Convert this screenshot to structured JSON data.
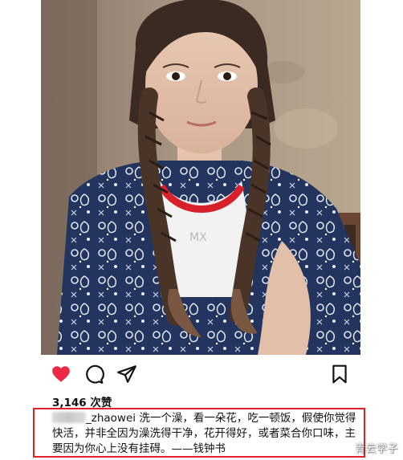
{
  "post": {
    "photo": {
      "subject": "selfie-photo"
    },
    "actions": {
      "like_icon": "heart-icon",
      "comment_icon": "comment-icon",
      "share_icon": "send-icon",
      "save_icon": "bookmark-icon",
      "like_color": "#ed2a45"
    },
    "likes_text": "3,146 次赞",
    "caption": {
      "username": "_zhaowei",
      "text": " 洗一个澡，看一朵花，吃一顿饭，假使你觉得快活，并非全因为澡洗得干净，花开得好，或者菜合你口味，主要因为你心上没有挂碍。——钱钟书"
    }
  },
  "watermark": "青云学子",
  "colors": {
    "highlight_border": "#e0202a"
  }
}
